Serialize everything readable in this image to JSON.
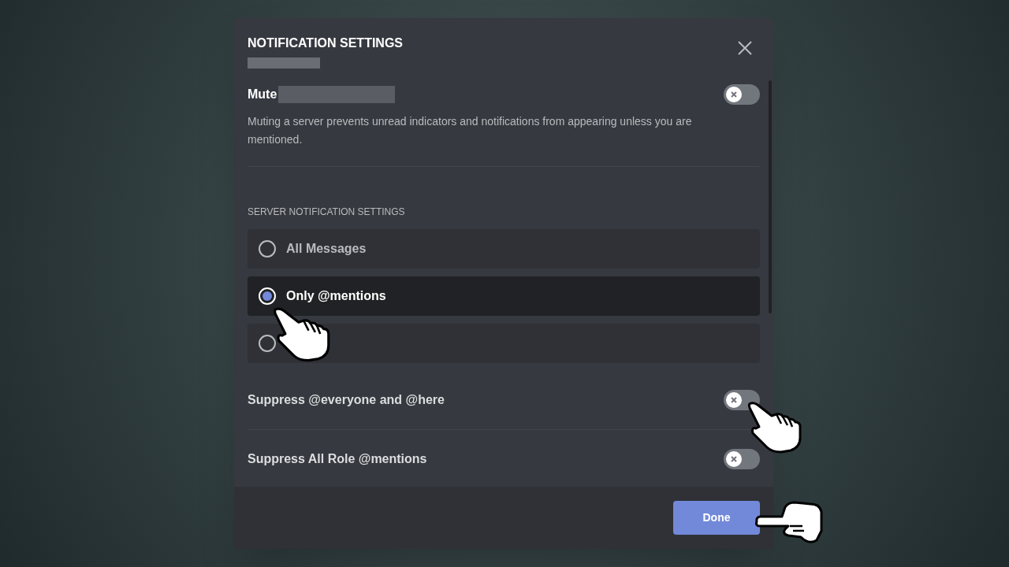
{
  "dialog": {
    "title": "NOTIFICATION SETTINGS",
    "mute": {
      "label": "Mute",
      "on": false
    },
    "mute_description": "Muting a server prevents unread indicators and notifications from appearing unless you are mentioned.",
    "section_header": "SERVER NOTIFICATION SETTINGS",
    "options": [
      {
        "label": "All Messages",
        "selected": false
      },
      {
        "label": "Only @mentions",
        "selected": true
      },
      {
        "selected": false
      }
    ],
    "toggles": [
      {
        "label": "Suppress @everyone and @here",
        "on": false
      },
      {
        "label": "Suppress All Role @mentions",
        "on": false
      }
    ],
    "done_button": "Done"
  }
}
